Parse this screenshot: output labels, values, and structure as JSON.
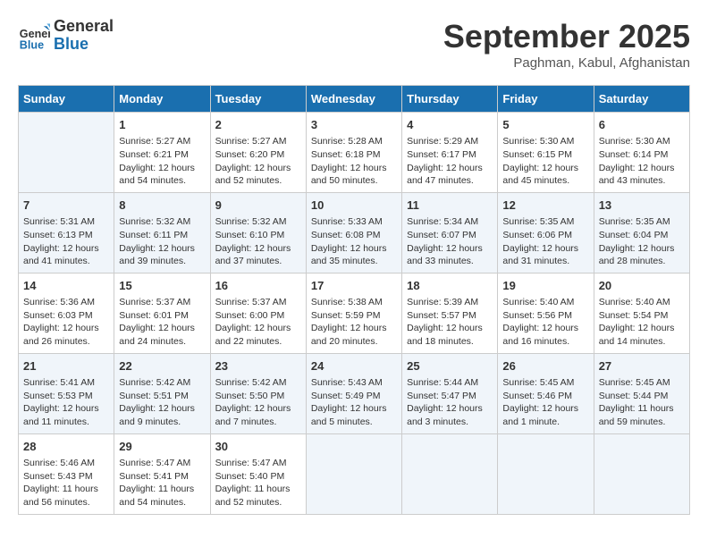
{
  "logo": {
    "line1": "General",
    "line2": "Blue"
  },
  "title": "September 2025",
  "location": "Paghman, Kabul, Afghanistan",
  "days_of_week": [
    "Sunday",
    "Monday",
    "Tuesday",
    "Wednesday",
    "Thursday",
    "Friday",
    "Saturday"
  ],
  "weeks": [
    [
      {
        "day": "",
        "info": ""
      },
      {
        "day": "1",
        "info": "Sunrise: 5:27 AM\nSunset: 6:21 PM\nDaylight: 12 hours\nand 54 minutes."
      },
      {
        "day": "2",
        "info": "Sunrise: 5:27 AM\nSunset: 6:20 PM\nDaylight: 12 hours\nand 52 minutes."
      },
      {
        "day": "3",
        "info": "Sunrise: 5:28 AM\nSunset: 6:18 PM\nDaylight: 12 hours\nand 50 minutes."
      },
      {
        "day": "4",
        "info": "Sunrise: 5:29 AM\nSunset: 6:17 PM\nDaylight: 12 hours\nand 47 minutes."
      },
      {
        "day": "5",
        "info": "Sunrise: 5:30 AM\nSunset: 6:15 PM\nDaylight: 12 hours\nand 45 minutes."
      },
      {
        "day": "6",
        "info": "Sunrise: 5:30 AM\nSunset: 6:14 PM\nDaylight: 12 hours\nand 43 minutes."
      }
    ],
    [
      {
        "day": "7",
        "info": "Sunrise: 5:31 AM\nSunset: 6:13 PM\nDaylight: 12 hours\nand 41 minutes."
      },
      {
        "day": "8",
        "info": "Sunrise: 5:32 AM\nSunset: 6:11 PM\nDaylight: 12 hours\nand 39 minutes."
      },
      {
        "day": "9",
        "info": "Sunrise: 5:32 AM\nSunset: 6:10 PM\nDaylight: 12 hours\nand 37 minutes."
      },
      {
        "day": "10",
        "info": "Sunrise: 5:33 AM\nSunset: 6:08 PM\nDaylight: 12 hours\nand 35 minutes."
      },
      {
        "day": "11",
        "info": "Sunrise: 5:34 AM\nSunset: 6:07 PM\nDaylight: 12 hours\nand 33 minutes."
      },
      {
        "day": "12",
        "info": "Sunrise: 5:35 AM\nSunset: 6:06 PM\nDaylight: 12 hours\nand 31 minutes."
      },
      {
        "day": "13",
        "info": "Sunrise: 5:35 AM\nSunset: 6:04 PM\nDaylight: 12 hours\nand 28 minutes."
      }
    ],
    [
      {
        "day": "14",
        "info": "Sunrise: 5:36 AM\nSunset: 6:03 PM\nDaylight: 12 hours\nand 26 minutes."
      },
      {
        "day": "15",
        "info": "Sunrise: 5:37 AM\nSunset: 6:01 PM\nDaylight: 12 hours\nand 24 minutes."
      },
      {
        "day": "16",
        "info": "Sunrise: 5:37 AM\nSunset: 6:00 PM\nDaylight: 12 hours\nand 22 minutes."
      },
      {
        "day": "17",
        "info": "Sunrise: 5:38 AM\nSunset: 5:59 PM\nDaylight: 12 hours\nand 20 minutes."
      },
      {
        "day": "18",
        "info": "Sunrise: 5:39 AM\nSunset: 5:57 PM\nDaylight: 12 hours\nand 18 minutes."
      },
      {
        "day": "19",
        "info": "Sunrise: 5:40 AM\nSunset: 5:56 PM\nDaylight: 12 hours\nand 16 minutes."
      },
      {
        "day": "20",
        "info": "Sunrise: 5:40 AM\nSunset: 5:54 PM\nDaylight: 12 hours\nand 14 minutes."
      }
    ],
    [
      {
        "day": "21",
        "info": "Sunrise: 5:41 AM\nSunset: 5:53 PM\nDaylight: 12 hours\nand 11 minutes."
      },
      {
        "day": "22",
        "info": "Sunrise: 5:42 AM\nSunset: 5:51 PM\nDaylight: 12 hours\nand 9 minutes."
      },
      {
        "day": "23",
        "info": "Sunrise: 5:42 AM\nSunset: 5:50 PM\nDaylight: 12 hours\nand 7 minutes."
      },
      {
        "day": "24",
        "info": "Sunrise: 5:43 AM\nSunset: 5:49 PM\nDaylight: 12 hours\nand 5 minutes."
      },
      {
        "day": "25",
        "info": "Sunrise: 5:44 AM\nSunset: 5:47 PM\nDaylight: 12 hours\nand 3 minutes."
      },
      {
        "day": "26",
        "info": "Sunrise: 5:45 AM\nSunset: 5:46 PM\nDaylight: 12 hours\nand 1 minute."
      },
      {
        "day": "27",
        "info": "Sunrise: 5:45 AM\nSunset: 5:44 PM\nDaylight: 11 hours\nand 59 minutes."
      }
    ],
    [
      {
        "day": "28",
        "info": "Sunrise: 5:46 AM\nSunset: 5:43 PM\nDaylight: 11 hours\nand 56 minutes."
      },
      {
        "day": "29",
        "info": "Sunrise: 5:47 AM\nSunset: 5:41 PM\nDaylight: 11 hours\nand 54 minutes."
      },
      {
        "day": "30",
        "info": "Sunrise: 5:47 AM\nSunset: 5:40 PM\nDaylight: 11 hours\nand 52 minutes."
      },
      {
        "day": "",
        "info": ""
      },
      {
        "day": "",
        "info": ""
      },
      {
        "day": "",
        "info": ""
      },
      {
        "day": "",
        "info": ""
      }
    ]
  ]
}
